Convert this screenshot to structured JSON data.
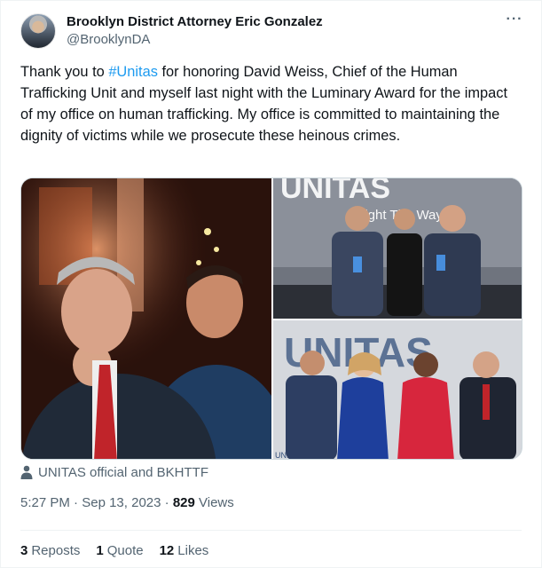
{
  "author": {
    "name": "Brooklyn District Attorney Eric Gonzalez",
    "handle": "@BrooklynDA"
  },
  "more_label": "···",
  "tweet": {
    "text_before": "Thank you to ",
    "hashtag": "#Unitas",
    "text_after": " for honoring David Weiss, Chief of the Human Trafficking Unit and myself last night with the Luminary Award for the impact of my office on human trafficking. My office is committed to maintaining the dignity of victims while we prosecute these heinous crimes."
  },
  "media": {
    "logo_text_top": "UNITAS",
    "logo_tagline": "Light The Way",
    "logo_text_bottom": "UNITAS",
    "logo_small": "UNI"
  },
  "media_caption": "UNITAS official and BKHTTF",
  "meta": {
    "time": "5:27 PM",
    "separator": "·",
    "date": "Sep 13, 2023",
    "views_count": "829",
    "views_label": "Views"
  },
  "stats": {
    "reposts_count": "3",
    "reposts_label": "Reposts",
    "quotes_count": "1",
    "quotes_label": "Quote",
    "likes_count": "12",
    "likes_label": "Likes"
  },
  "colors": {
    "link": "#1d9bf0",
    "secondary_text": "#536471",
    "primary_text": "#0f1419"
  }
}
